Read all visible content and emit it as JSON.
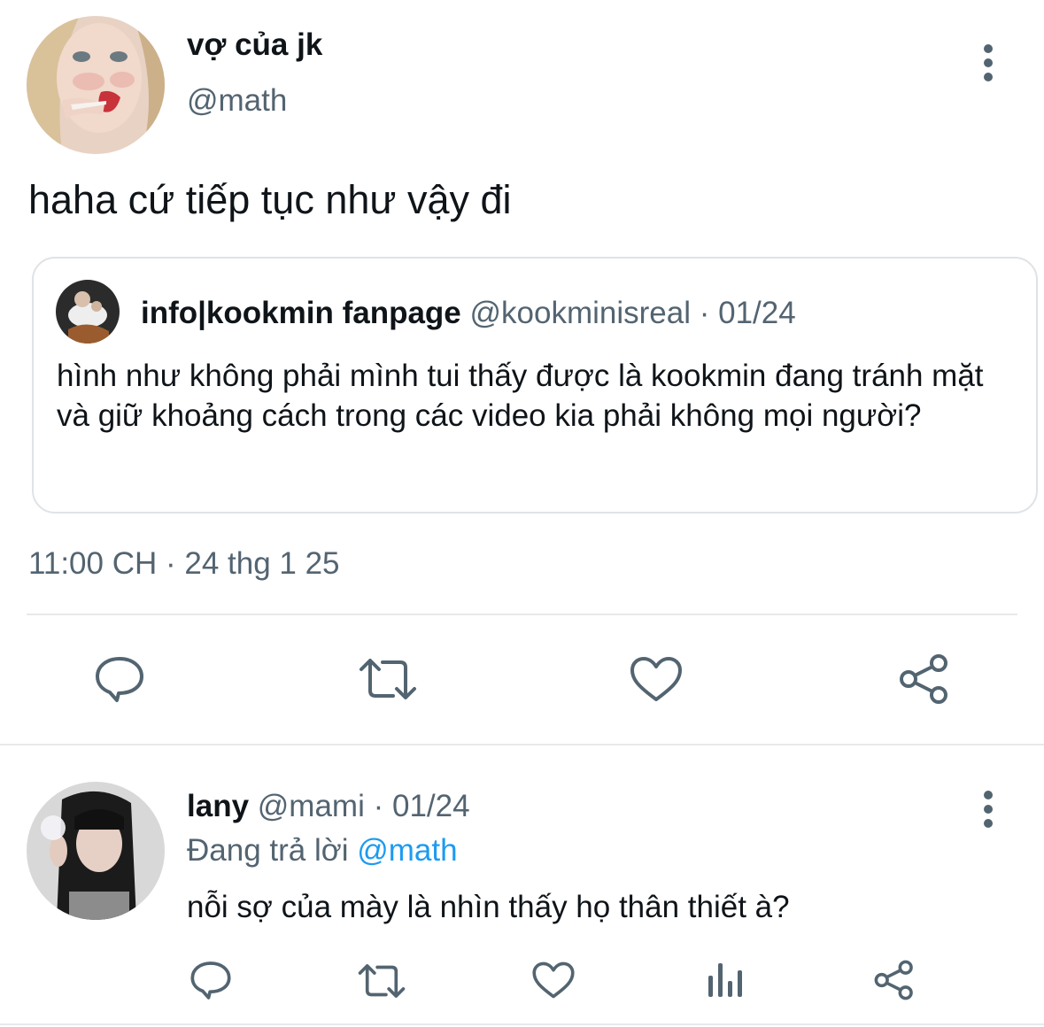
{
  "main_tweet": {
    "display_name": "vợ của jk",
    "handle": "@math",
    "text": "haha cứ tiếp tục như vậy đi",
    "timestamp": "11:00 CH · 24 thg 1 25"
  },
  "quoted_tweet": {
    "display_name": "info|kookmin fanpage",
    "handle": "@kookminisreal",
    "separator": "·",
    "date": "01/24",
    "text": "hình như không phải mình tui thấy được là kookmin đang tránh mặt và giữ khoảng cách trong các video kia phải không mọi người?"
  },
  "reply": {
    "display_name": "lany",
    "handle": "@mami",
    "separator": "·",
    "date": "01/24",
    "replying_prefix": "Đang trả lời",
    "replying_handle": "@math",
    "text": "nỗi sợ của mày là nhìn thấy họ thân thiết à?"
  },
  "icons": {
    "main_actions": [
      "reply-icon",
      "retweet-icon",
      "like-icon",
      "share-icon"
    ],
    "reply_actions": [
      "reply-icon",
      "retweet-icon",
      "like-icon",
      "views-icon",
      "share-icon"
    ],
    "more": "more-vertical-icon"
  },
  "colors": {
    "text": "#0f1419",
    "muted": "#536471",
    "link": "#1d9bf0",
    "divider": "#e7e9ea"
  }
}
